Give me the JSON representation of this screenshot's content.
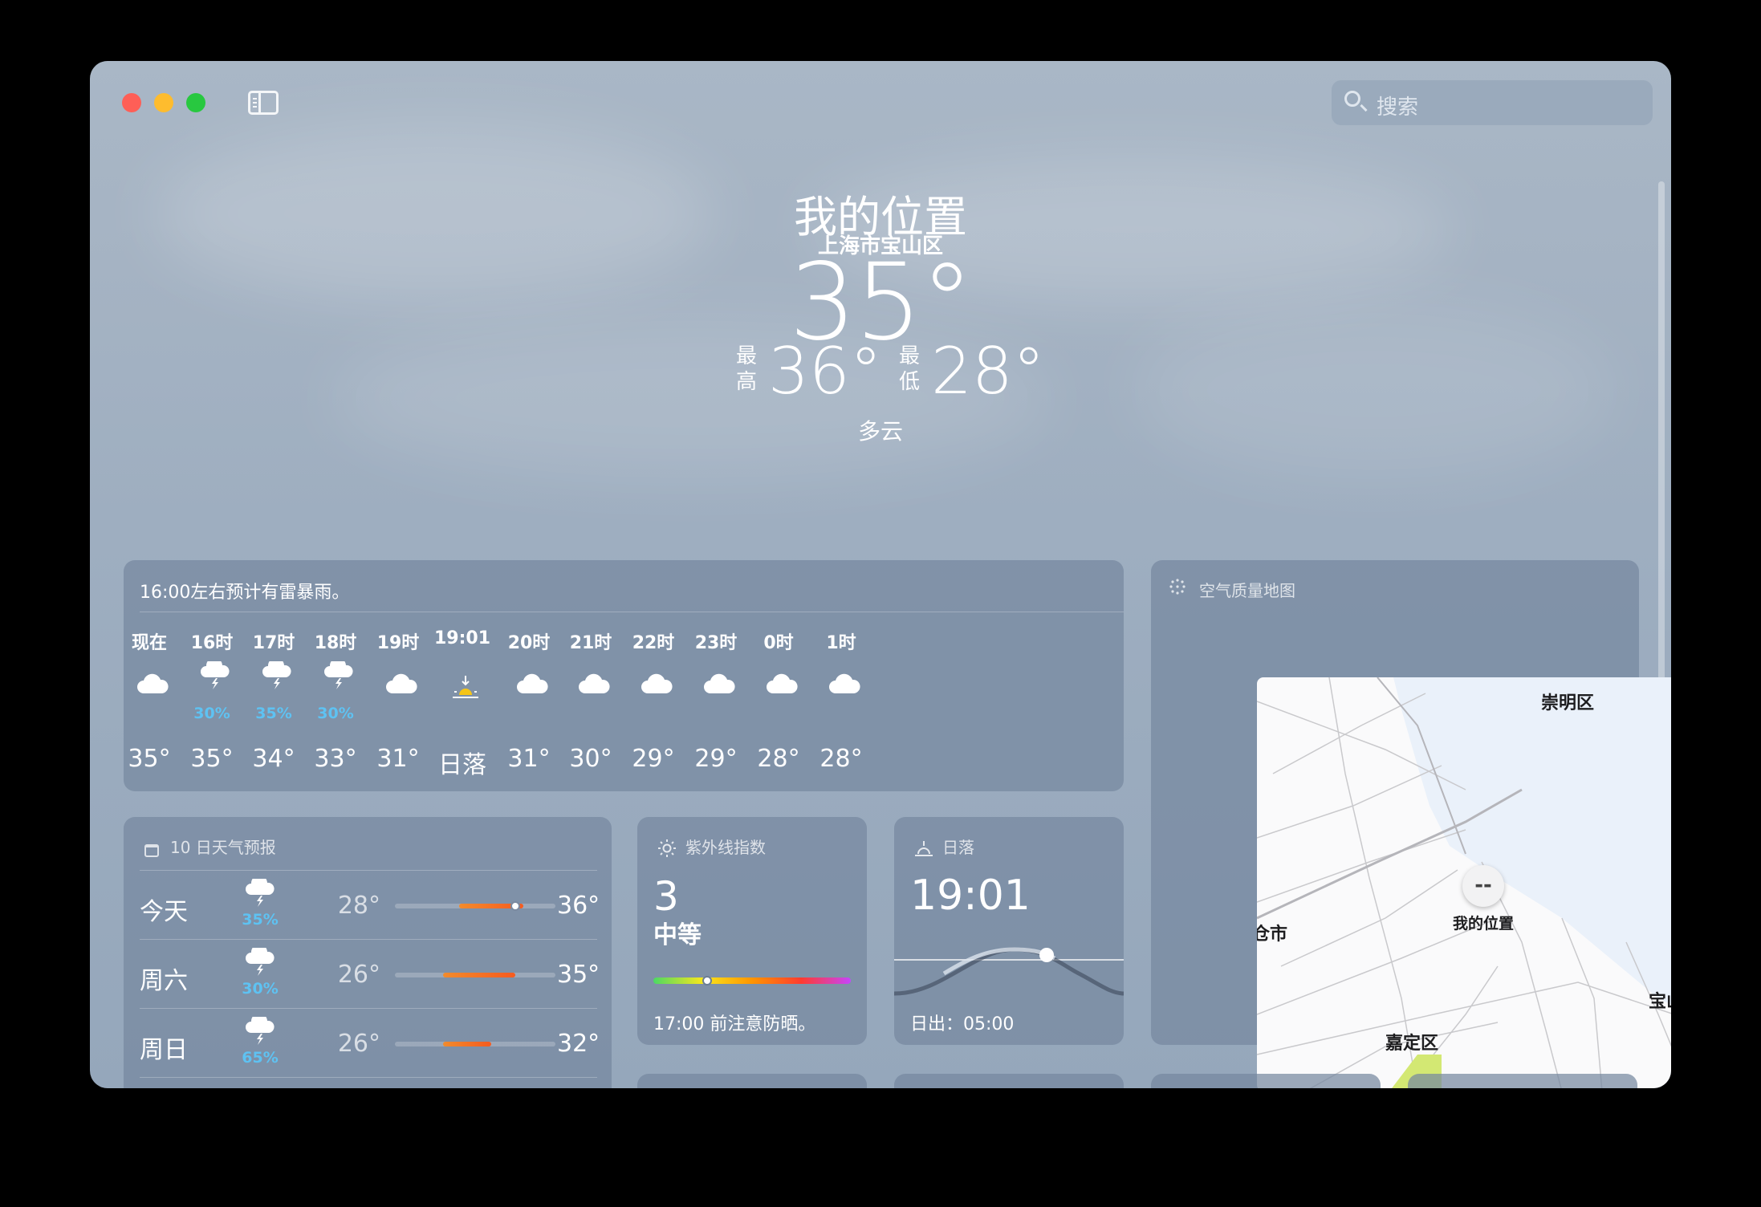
{
  "search": {
    "placeholder": "搜索"
  },
  "location": {
    "title": "我的位置",
    "subtitle": "上海市宝山区",
    "temperature": "35°",
    "high_label": "最高",
    "high": "36°",
    "low_label": "最低",
    "low": "28°",
    "condition": "多云"
  },
  "hourly": {
    "summary": "16:00左右预计有雷暴雨。",
    "items": [
      {
        "label": "现在",
        "icon": "cloud-icon",
        "precip": "",
        "temp": "35°"
      },
      {
        "label": "16时",
        "icon": "thunderstorm-icon",
        "precip": "30%",
        "temp": "35°"
      },
      {
        "label": "17时",
        "icon": "thunderstorm-icon",
        "precip": "35%",
        "temp": "34°"
      },
      {
        "label": "18时",
        "icon": "thunderstorm-icon",
        "precip": "30%",
        "temp": "33°"
      },
      {
        "label": "19时",
        "icon": "cloud-icon",
        "precip": "",
        "temp": "31°"
      },
      {
        "label": "19:01",
        "icon": "sunset-icon",
        "precip": "",
        "temp": "日落"
      },
      {
        "label": "20时",
        "icon": "cloud-icon",
        "precip": "",
        "temp": "31°"
      },
      {
        "label": "21时",
        "icon": "cloud-icon",
        "precip": "",
        "temp": "30°"
      },
      {
        "label": "22时",
        "icon": "cloud-icon",
        "precip": "",
        "temp": "29°"
      },
      {
        "label": "23时",
        "icon": "cloud-icon",
        "precip": "",
        "temp": "29°"
      },
      {
        "label": "0时",
        "icon": "cloud-icon",
        "precip": "",
        "temp": "28°"
      },
      {
        "label": "1时",
        "icon": "cloud-icon",
        "precip": "",
        "temp": "28°"
      }
    ]
  },
  "forecast": {
    "title": "10 日天气预报",
    "scale": {
      "min": 20,
      "max": 40
    },
    "days": [
      {
        "day": "今天",
        "icon": "thunderstorm-icon",
        "precip": "35%",
        "low": "28°",
        "high": "36°",
        "low_value": 28,
        "high_value": 36,
        "current_value": 35
      },
      {
        "day": "周六",
        "icon": "thunderstorm-icon",
        "precip": "30%",
        "low": "26°",
        "high": "35°",
        "low_value": 26,
        "high_value": 35
      },
      {
        "day": "周日",
        "icon": "thunderstorm-icon",
        "precip": "65%",
        "low": "26°",
        "high": "32°",
        "low_value": 26,
        "high_value": 32
      }
    ]
  },
  "uv": {
    "title": "紫外线指数",
    "value": "3",
    "level": "中等",
    "note": "17:00 前注意防晒。",
    "index_value": 3,
    "index_max": 11
  },
  "sunset": {
    "title": "日落",
    "time": "19:01",
    "sunrise": "日出：05:00"
  },
  "air_quality": {
    "title": "空气质量地图",
    "marker_value": "--",
    "marker_label": "我的位置",
    "places": [
      "崇明区",
      "仓市",
      "宝山区",
      "嘉定区"
    ]
  },
  "colors": {
    "precip": "#5ec2f2",
    "bar_warm": "#f28b2c",
    "bar_hot": "#f55b1f"
  }
}
